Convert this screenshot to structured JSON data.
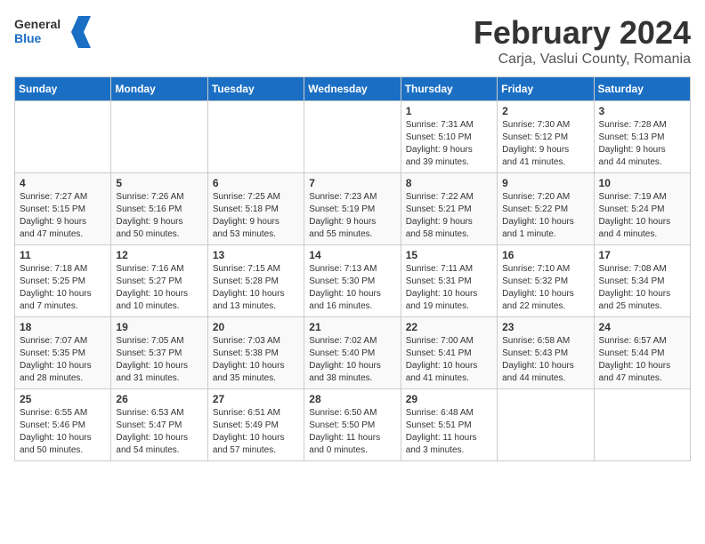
{
  "header": {
    "logo_general": "General",
    "logo_blue": "Blue",
    "month_title": "February 2024",
    "location": "Carja, Vaslui County, Romania"
  },
  "days_of_week": [
    "Sunday",
    "Monday",
    "Tuesday",
    "Wednesday",
    "Thursday",
    "Friday",
    "Saturday"
  ],
  "weeks": [
    [
      {
        "day": "",
        "info": ""
      },
      {
        "day": "",
        "info": ""
      },
      {
        "day": "",
        "info": ""
      },
      {
        "day": "",
        "info": ""
      },
      {
        "day": "1",
        "info": "Sunrise: 7:31 AM\nSunset: 5:10 PM\nDaylight: 9 hours\nand 39 minutes."
      },
      {
        "day": "2",
        "info": "Sunrise: 7:30 AM\nSunset: 5:12 PM\nDaylight: 9 hours\nand 41 minutes."
      },
      {
        "day": "3",
        "info": "Sunrise: 7:28 AM\nSunset: 5:13 PM\nDaylight: 9 hours\nand 44 minutes."
      }
    ],
    [
      {
        "day": "4",
        "info": "Sunrise: 7:27 AM\nSunset: 5:15 PM\nDaylight: 9 hours\nand 47 minutes."
      },
      {
        "day": "5",
        "info": "Sunrise: 7:26 AM\nSunset: 5:16 PM\nDaylight: 9 hours\nand 50 minutes."
      },
      {
        "day": "6",
        "info": "Sunrise: 7:25 AM\nSunset: 5:18 PM\nDaylight: 9 hours\nand 53 minutes."
      },
      {
        "day": "7",
        "info": "Sunrise: 7:23 AM\nSunset: 5:19 PM\nDaylight: 9 hours\nand 55 minutes."
      },
      {
        "day": "8",
        "info": "Sunrise: 7:22 AM\nSunset: 5:21 PM\nDaylight: 9 hours\nand 58 minutes."
      },
      {
        "day": "9",
        "info": "Sunrise: 7:20 AM\nSunset: 5:22 PM\nDaylight: 10 hours\nand 1 minute."
      },
      {
        "day": "10",
        "info": "Sunrise: 7:19 AM\nSunset: 5:24 PM\nDaylight: 10 hours\nand 4 minutes."
      }
    ],
    [
      {
        "day": "11",
        "info": "Sunrise: 7:18 AM\nSunset: 5:25 PM\nDaylight: 10 hours\nand 7 minutes."
      },
      {
        "day": "12",
        "info": "Sunrise: 7:16 AM\nSunset: 5:27 PM\nDaylight: 10 hours\nand 10 minutes."
      },
      {
        "day": "13",
        "info": "Sunrise: 7:15 AM\nSunset: 5:28 PM\nDaylight: 10 hours\nand 13 minutes."
      },
      {
        "day": "14",
        "info": "Sunrise: 7:13 AM\nSunset: 5:30 PM\nDaylight: 10 hours\nand 16 minutes."
      },
      {
        "day": "15",
        "info": "Sunrise: 7:11 AM\nSunset: 5:31 PM\nDaylight: 10 hours\nand 19 minutes."
      },
      {
        "day": "16",
        "info": "Sunrise: 7:10 AM\nSunset: 5:32 PM\nDaylight: 10 hours\nand 22 minutes."
      },
      {
        "day": "17",
        "info": "Sunrise: 7:08 AM\nSunset: 5:34 PM\nDaylight: 10 hours\nand 25 minutes."
      }
    ],
    [
      {
        "day": "18",
        "info": "Sunrise: 7:07 AM\nSunset: 5:35 PM\nDaylight: 10 hours\nand 28 minutes."
      },
      {
        "day": "19",
        "info": "Sunrise: 7:05 AM\nSunset: 5:37 PM\nDaylight: 10 hours\nand 31 minutes."
      },
      {
        "day": "20",
        "info": "Sunrise: 7:03 AM\nSunset: 5:38 PM\nDaylight: 10 hours\nand 35 minutes."
      },
      {
        "day": "21",
        "info": "Sunrise: 7:02 AM\nSunset: 5:40 PM\nDaylight: 10 hours\nand 38 minutes."
      },
      {
        "day": "22",
        "info": "Sunrise: 7:00 AM\nSunset: 5:41 PM\nDaylight: 10 hours\nand 41 minutes."
      },
      {
        "day": "23",
        "info": "Sunrise: 6:58 AM\nSunset: 5:43 PM\nDaylight: 10 hours\nand 44 minutes."
      },
      {
        "day": "24",
        "info": "Sunrise: 6:57 AM\nSunset: 5:44 PM\nDaylight: 10 hours\nand 47 minutes."
      }
    ],
    [
      {
        "day": "25",
        "info": "Sunrise: 6:55 AM\nSunset: 5:46 PM\nDaylight: 10 hours\nand 50 minutes."
      },
      {
        "day": "26",
        "info": "Sunrise: 6:53 AM\nSunset: 5:47 PM\nDaylight: 10 hours\nand 54 minutes."
      },
      {
        "day": "27",
        "info": "Sunrise: 6:51 AM\nSunset: 5:49 PM\nDaylight: 10 hours\nand 57 minutes."
      },
      {
        "day": "28",
        "info": "Sunrise: 6:50 AM\nSunset: 5:50 PM\nDaylight: 11 hours\nand 0 minutes."
      },
      {
        "day": "29",
        "info": "Sunrise: 6:48 AM\nSunset: 5:51 PM\nDaylight: 11 hours\nand 3 minutes."
      },
      {
        "day": "",
        "info": ""
      },
      {
        "day": "",
        "info": ""
      }
    ]
  ]
}
